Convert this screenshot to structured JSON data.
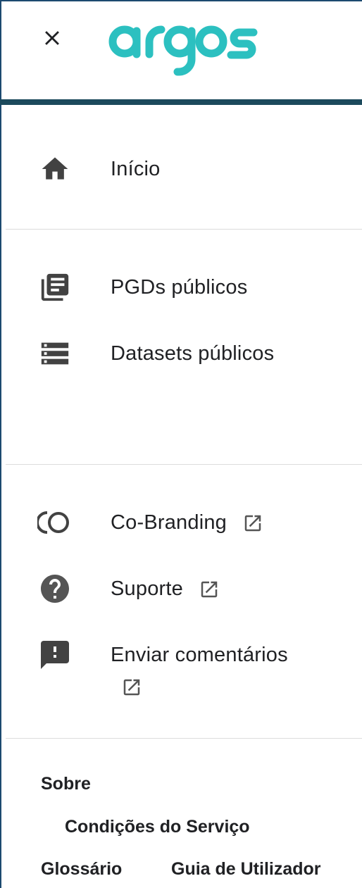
{
  "header": {
    "close_icon": "close-icon",
    "logo_text": "argos",
    "brand_color": "#2cc0c0",
    "bar_color": "#1c4a5c"
  },
  "nav": {
    "home": {
      "label": "Início",
      "icon": "home-icon"
    },
    "section_public": [
      {
        "label": "PGDs públicos",
        "icon": "library-books-icon"
      },
      {
        "label": "Datasets públicos",
        "icon": "storage-icon"
      }
    ],
    "section_external": [
      {
        "label": "Co-Branding",
        "icon": "co-branding-icon",
        "external": "open-in-new-icon"
      },
      {
        "label": "Suporte",
        "icon": "help-icon",
        "external": "open-in-new-icon"
      },
      {
        "label": "Enviar comentários",
        "icon": "feedback-icon",
        "external": "open-in-new-icon"
      }
    ]
  },
  "footer": {
    "about": "Sobre",
    "terms": "Condições do Serviço",
    "glossary": "Glossário",
    "user_guide": "Guia de Utilizador"
  }
}
